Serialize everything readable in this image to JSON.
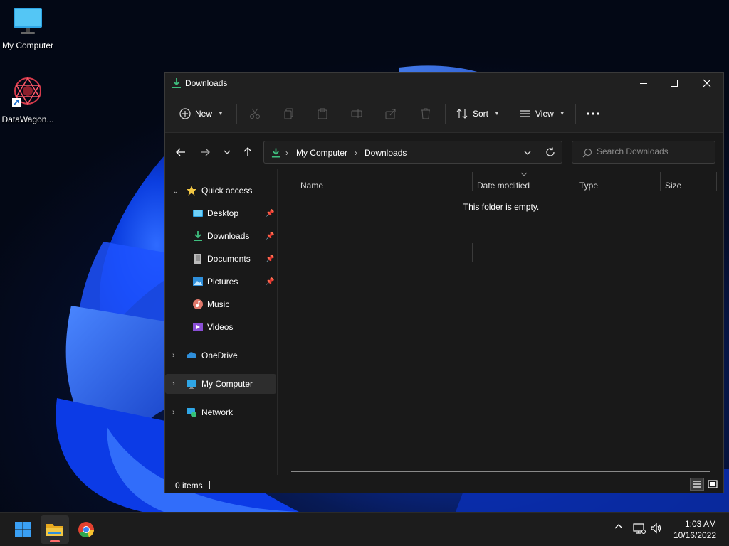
{
  "desktop": {
    "icons": [
      {
        "label": "My Computer",
        "icon": "monitor-icon"
      },
      {
        "label": "DataWagon...",
        "icon": "app-shortcut-icon"
      }
    ]
  },
  "window": {
    "title": "Downloads",
    "controls": {
      "minimize": "minimize-icon",
      "maximize": "maximize-icon",
      "close": "close-icon"
    }
  },
  "toolbar": {
    "new_label": "New",
    "sort_label": "Sort",
    "view_label": "View",
    "disabled_actions": [
      "cut",
      "copy",
      "paste",
      "rename",
      "share",
      "delete"
    ]
  },
  "address": {
    "crumbs": [
      "My Computer",
      "Downloads"
    ],
    "search_placeholder": "Search Downloads"
  },
  "sidebar": {
    "quick_access_label": "Quick access",
    "quick_items": [
      {
        "label": "Desktop",
        "pinned": true
      },
      {
        "label": "Downloads",
        "pinned": true
      },
      {
        "label": "Documents",
        "pinned": true
      },
      {
        "label": "Pictures",
        "pinned": true
      },
      {
        "label": "Music",
        "pinned": false
      },
      {
        "label": "Videos",
        "pinned": false
      }
    ],
    "onedrive_label": "OneDrive",
    "my_computer_label": "My Computer",
    "network_label": "Network"
  },
  "content": {
    "columns": [
      "Name",
      "Date modified",
      "Type",
      "Size"
    ],
    "empty_message": "This folder is empty."
  },
  "status": {
    "item_count": "0 items"
  },
  "taskbar": {
    "time": "1:03 AM",
    "date": "10/16/2022"
  },
  "colors": {
    "accent_green": "#3fbf7f",
    "folder_yellow": "#f2c744",
    "window_bg": "#191919"
  }
}
